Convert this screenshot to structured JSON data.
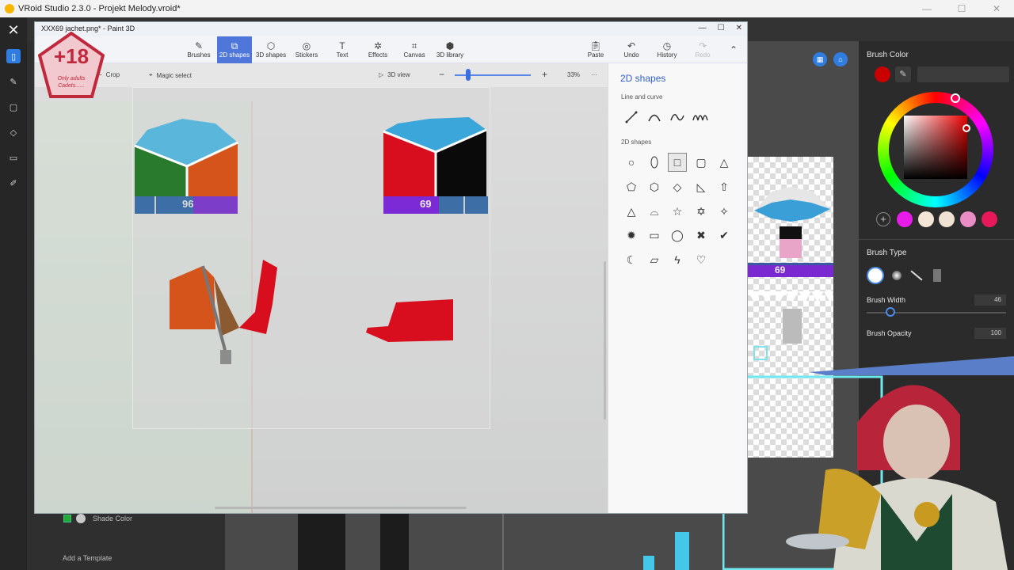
{
  "vroid": {
    "window_title": "VRoid Studio 2.3.0 - Projekt Melody.vroid*",
    "shade_color_label": "Shade Color",
    "add_template_label": "Add a Template",
    "brush_color_label": "Brush Color",
    "brush_color_hex": "#C80000",
    "brush_type_label": "Brush Type",
    "brush_width_label": "Brush Width",
    "brush_width_value": "46",
    "brush_opacity_label": "Brush Opacity",
    "brush_opacity_value": "100",
    "swatches": [
      "#c80000",
      "#e81ce8",
      "#f3e6d6",
      "#f0e2d2",
      "#ea8dc6",
      "#e8195b"
    ]
  },
  "paint3d": {
    "window_title": "XXX69 jachet.png* - Paint 3D",
    "ribbon": {
      "brushes": "Brushes",
      "shapes2d": "2D shapes",
      "shapes3d": "3D shapes",
      "stickers": "Stickers",
      "text": "Text",
      "effects": "Effects",
      "canvas": "Canvas",
      "library": "3D library",
      "paste": "Paste",
      "undo": "Undo",
      "history": "History",
      "redo": "Redo"
    },
    "subbar": {
      "crop": "Crop",
      "magic_select": "Magic select",
      "view3d": "3D view",
      "zoom": "33%",
      "more": "···"
    },
    "side_panel": {
      "title": "2D shapes",
      "line_section": "Line and curve",
      "shapes_section": "2D shapes"
    },
    "jacket_numbers": {
      "left": "96",
      "right": "69",
      "texture": "69"
    }
  },
  "overlay": {
    "line1": "+18",
    "line2": "Only adults",
    "line3": "Cadets......"
  }
}
